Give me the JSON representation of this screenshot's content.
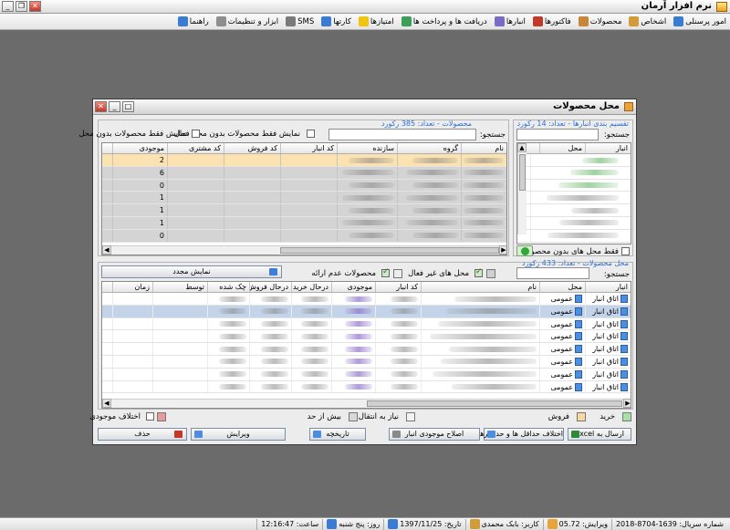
{
  "app": {
    "title": "نرم افزار آرمان"
  },
  "menu": [
    {
      "label": "امور پرسنلی",
      "icon": "people-icon",
      "color": "#3b7bd4"
    },
    {
      "label": "اشخاص",
      "icon": "person-icon",
      "color": "#d49b3b"
    },
    {
      "label": "محصولات",
      "icon": "box-icon",
      "color": "#c9853a"
    },
    {
      "label": "فاکتورها",
      "icon": "invoice-icon",
      "color": "#c0392b"
    },
    {
      "label": "انبارها",
      "icon": "warehouse-icon",
      "color": "#7a6cc4"
    },
    {
      "label": "دریافت ها و پرداخت ها",
      "icon": "money-icon",
      "color": "#3aa055"
    },
    {
      "label": "امتیازها",
      "icon": "star-icon",
      "color": "#f1c40f"
    },
    {
      "label": "کارتها",
      "icon": "card-icon",
      "color": "#3b7bd4"
    },
    {
      "label": "SMS",
      "icon": "sms-icon",
      "color": "#7a7a7a"
    },
    {
      "label": "ابزار و تنظیمات",
      "icon": "tools-icon",
      "color": "#8e8e8e"
    },
    {
      "label": "راهنما",
      "icon": "help-icon",
      "color": "#3b7bd4"
    }
  ],
  "dialog": {
    "title": "محل محصولات",
    "left_group": {
      "label": "تقسیم بندی انبارها - تعداد: 14 رکورد",
      "search_label": "جستجو:",
      "columns": [
        "انبار",
        "محل"
      ],
      "checkbox_label": "فقط محل های بدون محصول"
    },
    "right_group": {
      "label": "محصولات - تعداد: 385 رکورد",
      "search_label": "جستجو:",
      "cb_only_no_place": "نمایش فقط محصولات بدون محل",
      "cb_no_active_place": "نمایش فقط محصولات بدون محل فعال",
      "columns": [
        "نام",
        "گروه",
        "سازنده",
        "کد انبار",
        "کد فروش",
        "کد مشتری",
        "موجودی"
      ],
      "stock_values": [
        "2",
        "6",
        "0",
        "1",
        "1",
        "1",
        "0"
      ]
    },
    "bottom_group": {
      "label": "محل محصولات - تعداد: 433 رکورد",
      "search_label": "جستجو:",
      "cb_inactive_places": "محل های غیر فعال",
      "cb_not_offered": "محصولات عدم ارائه",
      "refresh_label": "نمایش مجدد",
      "columns": [
        "انبار",
        "محل",
        "نام",
        "کد انبار",
        "موجودی",
        "درحال خرید",
        "درحال فروش",
        "چک شده",
        "توسط",
        "زمان"
      ],
      "rows": [
        {
          "warehouse": "اتاق انبار",
          "place": "عمومی"
        },
        {
          "warehouse": "اتاق انبار",
          "place": "عمومی"
        },
        {
          "warehouse": "اتاق انبار",
          "place": "عمومی"
        },
        {
          "warehouse": "اتاق انبار",
          "place": "عمومی"
        },
        {
          "warehouse": "اتاق انبار",
          "place": "عمومی"
        },
        {
          "warehouse": "اتاق انبار",
          "place": "عمومی"
        },
        {
          "warehouse": "اتاق انبار",
          "place": "عمومی"
        },
        {
          "warehouse": "اتاق انبار",
          "place": "عمومی"
        }
      ]
    },
    "legend": {
      "buy": "خرید",
      "sell": "فروش",
      "need_transfer": "نیاز به انتقال",
      "over_limit": "بیش از حد",
      "stock_diff": "اختلاف موجودی",
      "colors": {
        "buy": "#a8e0a8",
        "sell": "#f6d9a0",
        "transfer": "#f2f2f2",
        "over": "#d8d8d8",
        "diff": "#e89a9a"
      }
    },
    "buttons": {
      "excel": "ارسال به Excel",
      "limit_diff": "اختلاف حداقل ها و حداکثرها",
      "fix_stock": "اصلاح موجودی انبار",
      "history": "تاریخچه",
      "edit": "ویرایش",
      "delete": "حذف"
    }
  },
  "status": {
    "serial": "شماره سریال: 1639-8704-2018",
    "version": "ویرایش: 05.72",
    "user": "کاربر: بابک محمدی",
    "date": "تاریخ: 1397/11/25",
    "day": "روز: پنج شنبه",
    "time": "ساعت: 12:16:47"
  }
}
